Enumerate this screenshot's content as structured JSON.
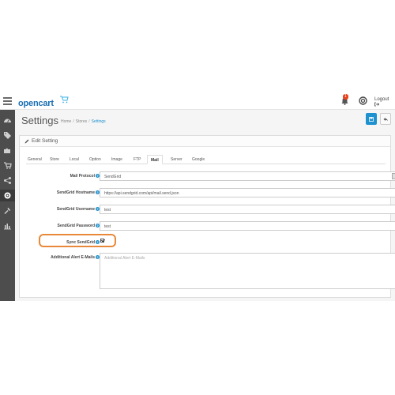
{
  "header": {
    "logo_text": "opencart",
    "alert_count": "1",
    "logout_label": "Logout"
  },
  "sidebar": {
    "items": [
      {
        "icon": "dashboard-icon"
      },
      {
        "icon": "tag-icon"
      },
      {
        "icon": "puzzle-icon"
      },
      {
        "icon": "cart-icon"
      },
      {
        "icon": "share-icon"
      },
      {
        "icon": "cog-icon",
        "active": true
      },
      {
        "icon": "wrench-icon"
      },
      {
        "icon": "bar-chart-icon"
      }
    ]
  },
  "page": {
    "title": "Settings",
    "breadcrumb": [
      "Home",
      "Stores",
      "Settings"
    ]
  },
  "panel": {
    "title": "Edit Setting",
    "tabs": [
      "General",
      "Store",
      "Local",
      "Option",
      "Image",
      "FTP",
      "Mail",
      "Server",
      "Google"
    ],
    "active_tab": "Mail"
  },
  "form": {
    "mail_protocol": {
      "label": "Mail Protocol",
      "value": "SendGrid"
    },
    "sendgrid_hostname": {
      "label": "SendGrid Hostname",
      "value": "https://api.sendgrid.com/api/mail.send.json"
    },
    "sendgrid_username": {
      "label": "SendGrid Username",
      "value": "test"
    },
    "sendgrid_password": {
      "label": "SendGrid Password",
      "value": "test"
    },
    "sync_sendgrid": {
      "label": "Sync SendGrid",
      "checked": true
    },
    "additional_emails": {
      "label": "Additional Alert E-Mails",
      "placeholder": "Additional Alert E-Mails"
    }
  },
  "colors": {
    "brand": "#1e91cf",
    "sidebar": "#4d4d4d",
    "highlight": "#e8893a",
    "alert": "#e8401c"
  }
}
